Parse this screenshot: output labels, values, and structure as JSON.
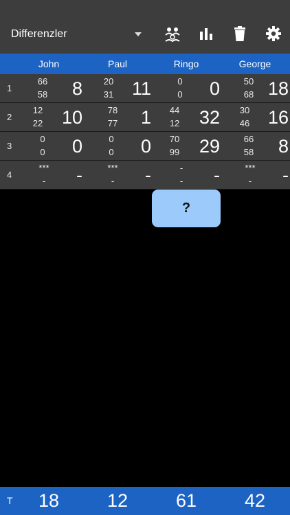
{
  "toolbar": {
    "game_label": "Differenzler",
    "icons": [
      "players-icon",
      "bar-chart-icon",
      "trash-icon",
      "gear-icon"
    ]
  },
  "players": [
    "John",
    "Paul",
    "Ringo",
    "George"
  ],
  "rounds": [
    {
      "num": "1",
      "cells": [
        {
          "top": "66",
          "bot": "58",
          "big": "8"
        },
        {
          "top": "20",
          "bot": "31",
          "big": "11"
        },
        {
          "top": "0",
          "bot": "0",
          "big": "0"
        },
        {
          "top": "50",
          "bot": "68",
          "big": "18"
        }
      ]
    },
    {
      "num": "2",
      "cells": [
        {
          "top": "12",
          "bot": "22",
          "big": "10"
        },
        {
          "top": "78",
          "bot": "77",
          "big": "1"
        },
        {
          "top": "44",
          "bot": "12",
          "big": "32"
        },
        {
          "top": "30",
          "bot": "46",
          "big": "16"
        }
      ]
    },
    {
      "num": "3",
      "cells": [
        {
          "top": "0",
          "bot": "0",
          "big": "0"
        },
        {
          "top": "0",
          "bot": "0",
          "big": "0"
        },
        {
          "top": "70",
          "bot": "99",
          "big": "29"
        },
        {
          "top": "66",
          "bot": "58",
          "big": "8"
        }
      ]
    },
    {
      "num": "4",
      "cells": [
        {
          "top": "***",
          "bot": "-",
          "big": "-"
        },
        {
          "top": "***",
          "bot": "-",
          "big": "-"
        },
        {
          "top": "-",
          "bot": "-",
          "big": "-"
        },
        {
          "top": "***",
          "bot": "-",
          "big": "-"
        }
      ]
    }
  ],
  "popup": {
    "label": "?"
  },
  "totals": {
    "label": "T",
    "values": [
      "18",
      "12",
      "61",
      "42"
    ]
  },
  "colors": {
    "toolbar": "#3d3d3d",
    "header": "#1d63c3",
    "popup": "#9ccbfb",
    "background": "#000000"
  }
}
